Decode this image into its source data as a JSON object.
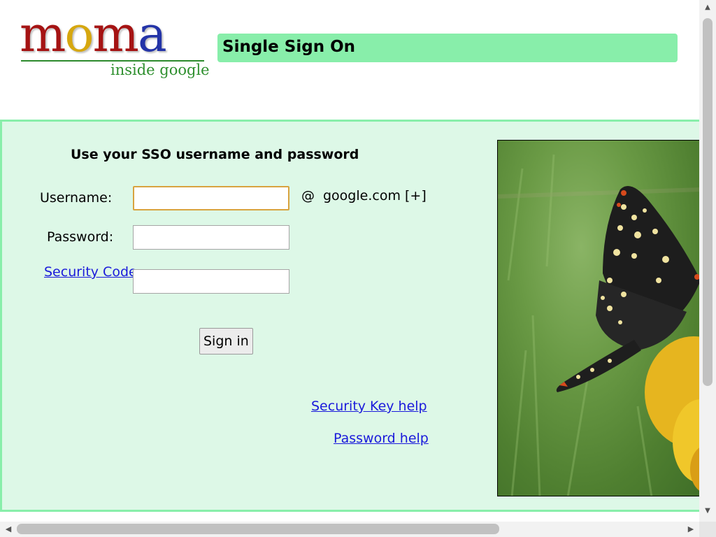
{
  "header": {
    "logo_word_parts": [
      "m",
      "o",
      "m",
      "a"
    ],
    "logo_tagline": "inside google",
    "title": "Single Sign On"
  },
  "form": {
    "heading": "Use your SSO username and password",
    "username_label": "Username:",
    "username_value": "",
    "domain_at": "@",
    "domain": "google.com [+]",
    "password_label": "Password:",
    "password_value": "",
    "security_code_link": "Security Code",
    "security_code_suffix": ":",
    "security_code_value": "",
    "signin_button": "Sign in"
  },
  "help_links": {
    "security_key": "Security Key help",
    "password": "Password help"
  },
  "colors": {
    "title_bar": "#88eeaa",
    "panel_background": "#ddf8e7",
    "link": "#1a1adb",
    "focus_border": "#d8a33f"
  },
  "photo": {
    "subject": "butterfly on yellow flower"
  }
}
